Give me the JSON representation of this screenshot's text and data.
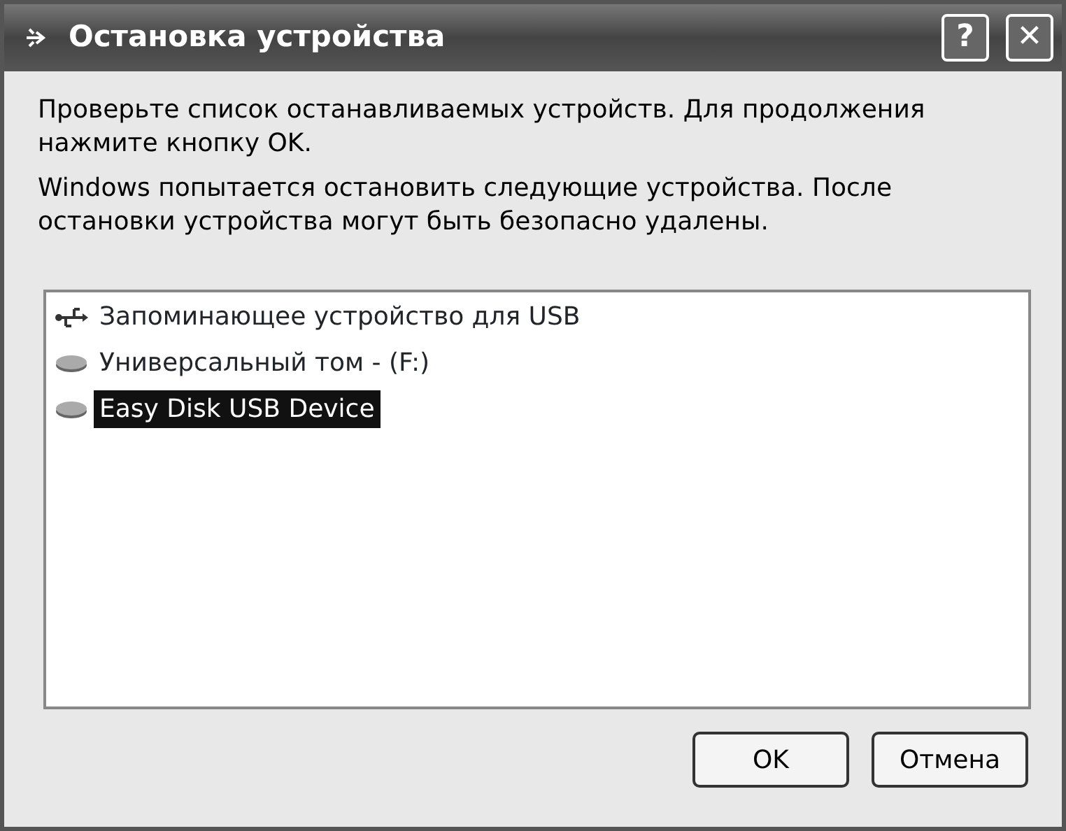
{
  "window": {
    "title": "Остановка устройства",
    "help_button": "?",
    "close_button": "✕"
  },
  "messages": [
    "Проверьте список останавливаемых устройств. Для продолжения нажмите кнопку OK.",
    "Windows попытается остановить следующие устройства. После остановки устройства могут быть безопасно удалены."
  ],
  "devices": [
    {
      "label": "Запоминающее устройство для USB",
      "kind": "usb",
      "selected": false
    },
    {
      "label": "Универсальный том - (F:)",
      "kind": "disk",
      "selected": false
    },
    {
      "label": "Easy Disk USB Device",
      "kind": "disk",
      "selected": true
    }
  ],
  "buttons": [
    "OK",
    "Отмена"
  ]
}
